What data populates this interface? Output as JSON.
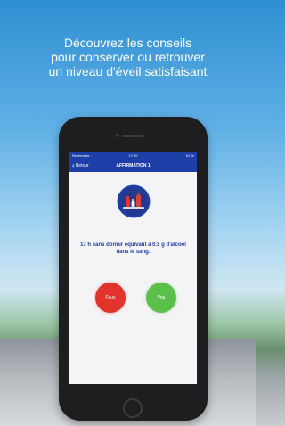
{
  "headline": {
    "line1": "Découvrez les conseils",
    "line2": "pour conserver ou retrouver",
    "line3": "un niveau d'éveil satisfaisant"
  },
  "status_bar": {
    "carrier": "Recherche...",
    "time": "17:20",
    "battery": "61 %"
  },
  "nav": {
    "back_label": "Retour",
    "title": "AFFIRMATION 1"
  },
  "quiz": {
    "statement_line1": "17 h sans dormir équivaut à 0.5 g d'alcool",
    "statement_line2": "dans le sang.",
    "false_label": "Faux",
    "true_label": "Vrai"
  },
  "colors": {
    "brand_blue": "#1f3fa8",
    "false_red": "#e0342d",
    "true_green": "#5bbf4c"
  },
  "icons": [
    "back-chevron-icon",
    "wifi-icon",
    "drinks-illustration"
  ]
}
